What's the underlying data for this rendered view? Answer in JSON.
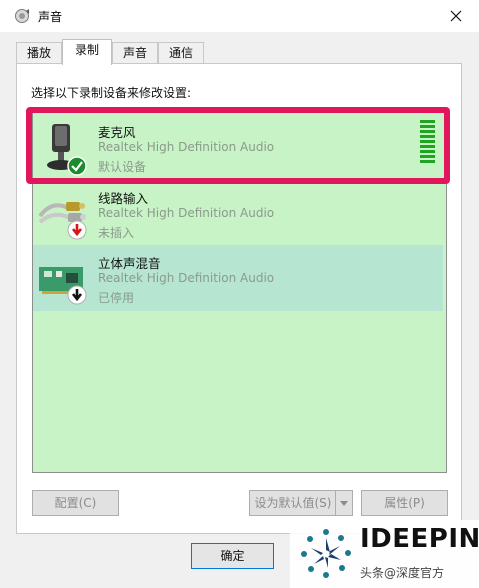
{
  "window": {
    "title": "声音"
  },
  "tabs": [
    {
      "label": "播放"
    },
    {
      "label": "录制"
    },
    {
      "label": "声音"
    },
    {
      "label": "通信"
    }
  ],
  "panel": {
    "instruction": "选择以下录制设备来修改设置:",
    "devices": [
      {
        "name": "麦克风",
        "driver": "Realtek High Definition Audio",
        "status": "默认设备",
        "icon": "microphone-icon",
        "badge": "check-icon",
        "level_bars": 9
      },
      {
        "name": "线路输入",
        "driver": "Realtek High Definition Audio",
        "status": "未插入",
        "icon": "line-in-cable-icon",
        "badge": "red-down-arrow-icon"
      },
      {
        "name": "立体声混音",
        "driver": "Realtek High Definition Audio",
        "status": "已停用",
        "icon": "sound-card-icon",
        "badge": "black-down-arrow-icon"
      }
    ]
  },
  "buttons": {
    "configure": "配置(C)",
    "set_default": "设为默认值(S)",
    "properties": "属性(P)",
    "ok": "确定"
  },
  "watermark": {
    "logo": "IDEEPIN",
    "text": "头条@深度官方"
  },
  "colors": {
    "selected_highlight": "#e2165c",
    "list_background": "#c7f3c6",
    "level_meter": "#1fa51f"
  }
}
